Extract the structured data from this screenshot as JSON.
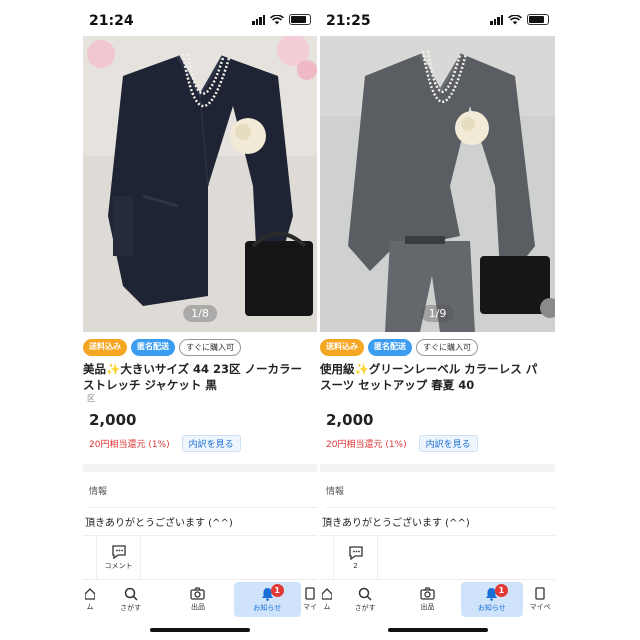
{
  "left": {
    "time": "21:24",
    "pager": "1/8",
    "badges": [
      "送料込み",
      "匿名配送",
      "すぐに購入可"
    ],
    "title_line1": "美品✨大きいサイズ 44 23区 ノーカラー",
    "title_line2": "ストレッチ ジャケット 黒",
    "sub": "区",
    "price": "2,000",
    "points": "20円相当還元 (1%)",
    "breakdown": "内訳を見る",
    "info_head": "情報",
    "info_body": "頂きありがとうございます (^^)",
    "action_label": "コメント",
    "tabs": [
      "ム",
      "さがす",
      "出品",
      "お知らせ",
      "マイ"
    ],
    "notif_count": "1",
    "colors": {
      "garment": "#1e2433",
      "background": "#d9d6d2"
    }
  },
  "right": {
    "time": "21:25",
    "pager": "1/9",
    "badges": [
      "送料込み",
      "匿名配送",
      "すぐに購入可"
    ],
    "title_line1": "使用級✨グリーンレーベル カラーレス パ",
    "title_line2": "スーツ セットアップ 春夏 40",
    "price": "2,000",
    "points": "20円相当還元 (1%)",
    "breakdown": "内訳を見る",
    "info_head": "情報",
    "info_body": "頂きありがとうございます (^^)",
    "action_label": "2",
    "tabs": [
      "ム",
      "さがす",
      "出品",
      "お知らせ",
      "マイペ"
    ],
    "notif_count": "1",
    "colors": {
      "garment": "#5a5d62",
      "background": "#cfd0d0"
    }
  },
  "icons": [
    "signal-icon",
    "wifi-icon",
    "battery-icon",
    "comment-icon",
    "home-icon",
    "search-icon",
    "camera-icon",
    "bell-icon",
    "mypage-icon"
  ],
  "accent": {
    "orange": "#f5a623",
    "blue": "#3b9cf0",
    "red": "#e53935",
    "link": "#1a6ed8"
  }
}
